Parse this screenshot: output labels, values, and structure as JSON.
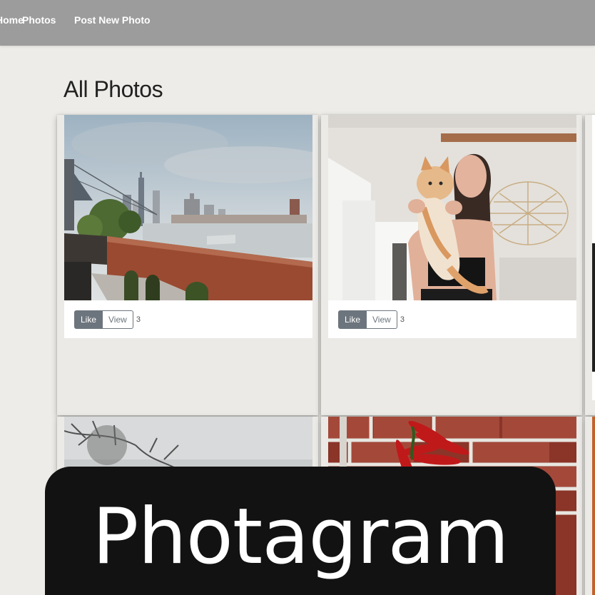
{
  "nav": {
    "home_label": "Home",
    "photos_label": "Photos",
    "post_label": "Post New Photo"
  },
  "page": {
    "title": "All Photos"
  },
  "photos": [
    {
      "subject": "city-skyline-brick-rooftop",
      "like_label": "Like",
      "view_label": "View",
      "likes": "3"
    },
    {
      "subject": "woman-holding-orange-cat",
      "like_label": "Like",
      "view_label": "View",
      "likes": "3"
    },
    {
      "subject": "pine-branches-grey-sky"
    },
    {
      "subject": "red-peppers-brick-wall"
    }
  ],
  "banner": {
    "title": "Photagram"
  },
  "colors": {
    "navbar": "#9c9c9c",
    "background": "#edece8",
    "like_button": "#6c757d",
    "overlay": "#121212"
  }
}
